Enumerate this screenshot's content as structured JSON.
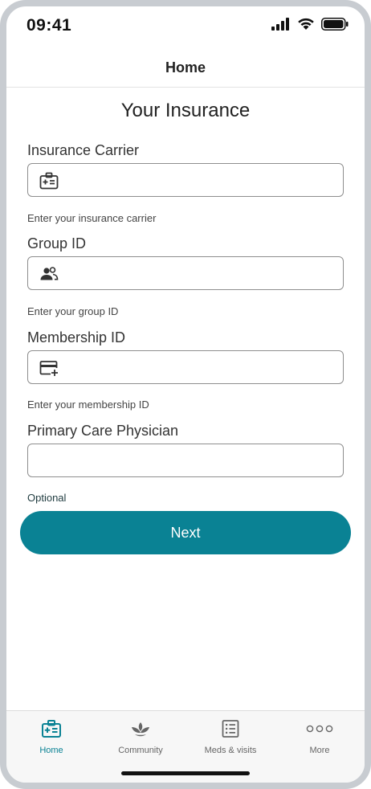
{
  "status_bar": {
    "time": "09:41"
  },
  "nav": {
    "title": "Home"
  },
  "page": {
    "title": "Your Insurance"
  },
  "fields": {
    "carrier": {
      "label": "Insurance Carrier",
      "value": "",
      "help": "Enter your insurance carrier",
      "icon": "medical-card-icon"
    },
    "group": {
      "label": "Group ID",
      "value": "",
      "help": "Enter your group ID",
      "icon": "group-icon"
    },
    "membership": {
      "label": "Membership ID",
      "value": "",
      "help": "Enter your membership ID",
      "icon": "credit-card-add-icon"
    },
    "physician": {
      "label": "Primary Care Physician",
      "value": "",
      "help": "Optional"
    }
  },
  "actions": {
    "next_label": "Next"
  },
  "tabs": [
    {
      "label": "Home",
      "icon": "medical-card-icon",
      "active": true
    },
    {
      "label": "Community",
      "icon": "lotus-icon",
      "active": false
    },
    {
      "label": "Meds & visits",
      "icon": "list-icon",
      "active": false
    },
    {
      "label": "More",
      "icon": "more-dots-icon",
      "active": false
    }
  ],
  "colors": {
    "accent": "#0a8294",
    "inactive": "#666666",
    "border": "#8e8e8e"
  }
}
